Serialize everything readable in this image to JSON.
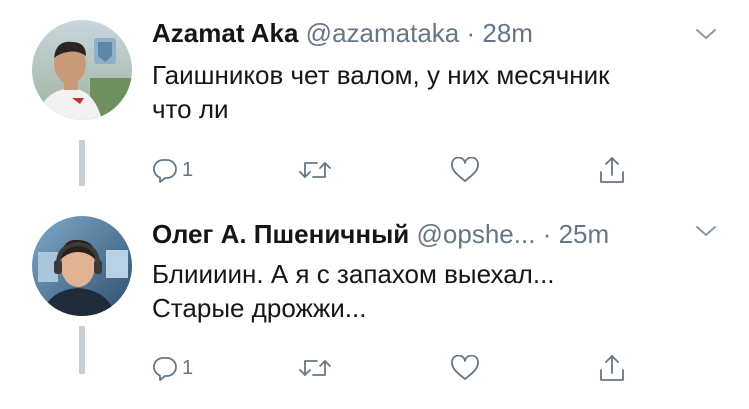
{
  "tweets": [
    {
      "display_name": "Azamat Aka",
      "handle": "@azamataka",
      "separator": "·",
      "time": "28m",
      "text_lines": [
        "Гаишников чет валом, у них месячник",
        "что ли"
      ],
      "reply_count": "1",
      "avatar_icon": "profile-photo"
    },
    {
      "display_name": "Олег А. Пшеничный",
      "handle": "@opshe...",
      "separator": "·",
      "time": "25m",
      "text_lines": [
        "Блиииин. А я с запахом выехал...",
        "Старые дрожжи..."
      ],
      "reply_count": "1",
      "avatar_icon": "profile-photo"
    }
  ],
  "icons": {
    "reply": "reply-icon",
    "retweet": "retweet-icon",
    "like": "heart-icon",
    "share": "share-icon",
    "menu": "chevron-down-icon"
  },
  "colors": {
    "text": "#14171a",
    "secondary": "#657786",
    "thread_line": "#c4cfd6",
    "background": "#ffffff"
  }
}
